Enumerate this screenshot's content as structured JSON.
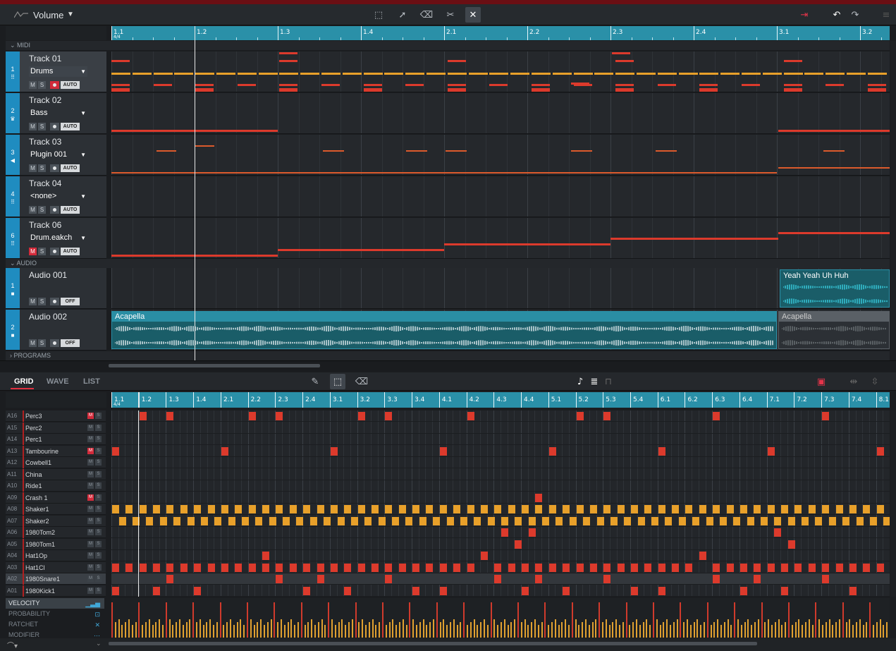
{
  "toolbar": {
    "automation_param": "Volume",
    "icons": [
      "line-wave-icon",
      "marquee-select-icon",
      "pointer-tool-icon",
      "eraser-tool-icon",
      "scissors-tool-icon",
      "mute-tool-icon",
      "snap-icon",
      "undo-icon",
      "redo-icon",
      "menu-icon"
    ]
  },
  "arrange": {
    "ruler_labels": [
      "1.1",
      "1.2",
      "1.3",
      "1.4",
      "2.1",
      "2.2",
      "2.3",
      "2.4",
      "3.1",
      "3.2"
    ],
    "ruler_sub": "4/4",
    "sections": {
      "midi": "MIDI",
      "audio": "AUDIO",
      "programs": "PROGRAMS"
    },
    "tracks": [
      {
        "num": "1",
        "name": "Track 01",
        "program": "Drums",
        "mute": "M",
        "solo": "S",
        "auto": "AUTO",
        "mute_on": false,
        "rec_on": true,
        "icon": "pads-icon"
      },
      {
        "num": "2",
        "name": "Track 02",
        "program": "Bass",
        "mute": "M",
        "solo": "S",
        "auto": "AUTO",
        "mute_on": false,
        "rec_on": false,
        "icon": "keys-icon"
      },
      {
        "num": "3",
        "name": "Track 03",
        "program": "Plugin 001",
        "mute": "M",
        "solo": "S",
        "auto": "AUTO",
        "mute_on": false,
        "rec_on": false,
        "icon": "plugin-icon"
      },
      {
        "num": "4",
        "name": "Track 04",
        "program": "<none>",
        "mute": "M",
        "solo": "S",
        "auto": "AUTO",
        "mute_on": false,
        "rec_on": false,
        "icon": "pads-icon"
      },
      {
        "num": "6",
        "name": "Track 06",
        "program": "Drum.eakch",
        "mute": "M",
        "solo": "S",
        "auto": "AUTO",
        "mute_on": true,
        "rec_on": false,
        "icon": "pads-icon"
      }
    ],
    "audio_tracks": [
      {
        "num": "1",
        "name": "Audio 001",
        "mute": "M",
        "solo": "S",
        "auto": "OFF",
        "clip": "Yeah Yeah Uh Huh"
      },
      {
        "num": "2",
        "name": "Audio 002",
        "mute": "M",
        "solo": "S",
        "auto": "OFF",
        "clip": "Acapella",
        "clip2": "Acapella"
      }
    ]
  },
  "editor": {
    "tabs": [
      "GRID",
      "WAVE",
      "LIST"
    ],
    "active_tab": "GRID",
    "ruler_labels": [
      "1.1",
      "1.2",
      "1.3",
      "1.4",
      "2.1",
      "2.2",
      "2.3",
      "2.4",
      "3.1",
      "3.2",
      "3.3",
      "3.4",
      "4.1",
      "4.2",
      "4.3",
      "4.4",
      "5.1",
      "5.2",
      "5.3",
      "5.4",
      "6.1",
      "6.2",
      "6.3",
      "6.4",
      "7.1",
      "7.2",
      "7.3",
      "7.4",
      "8.1"
    ],
    "ruler_sub": "4/4",
    "pads": [
      {
        "id": "A16",
        "name": "Perc3",
        "mute_on": true
      },
      {
        "id": "A15",
        "name": "Perc2",
        "mute_on": false
      },
      {
        "id": "A14",
        "name": "Perc1",
        "mute_on": false
      },
      {
        "id": "A13",
        "name": "Tambourine",
        "mute_on": true
      },
      {
        "id": "A12",
        "name": "Cowbell1",
        "mute_on": false
      },
      {
        "id": "A11",
        "name": "China",
        "mute_on": false
      },
      {
        "id": "A10",
        "name": "Ride1",
        "mute_on": false
      },
      {
        "id": "A09",
        "name": "Crash 1",
        "mute_on": true
      },
      {
        "id": "A08",
        "name": "Shaker1",
        "mute_on": false
      },
      {
        "id": "A07",
        "name": "Shaker2",
        "mute_on": false
      },
      {
        "id": "A06",
        "name": "1980Tom2",
        "mute_on": false
      },
      {
        "id": "A05",
        "name": "1980Tom1",
        "mute_on": false
      },
      {
        "id": "A04",
        "name": "Hat1Op",
        "mute_on": false
      },
      {
        "id": "A03",
        "name": "Hat1Cl",
        "mute_on": false
      },
      {
        "id": "A02",
        "name": "1980Snare1",
        "mute_on": false
      },
      {
        "id": "A01",
        "name": "1980Kick1",
        "mute_on": false
      }
    ],
    "mute_label": "M",
    "solo_label": "S",
    "lanes": [
      {
        "label": "VELOCITY",
        "icon": "velocity-icon"
      },
      {
        "label": "PROBABILITY",
        "icon": "probability-icon"
      },
      {
        "label": "RATCHET",
        "icon": "ratchet-icon"
      },
      {
        "label": "MODIFIER",
        "icon": "modifier-icon"
      }
    ]
  },
  "colors": {
    "accent_red": "#dc3a2c",
    "accent_orange": "#e8a02a",
    "track_blue": "#1f8cc0",
    "ruler_teal": "#2a90a8"
  }
}
